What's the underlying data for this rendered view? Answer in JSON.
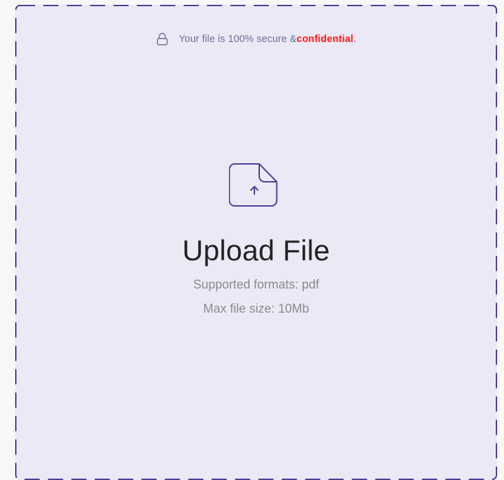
{
  "security_note": {
    "prefix": "Your file is 100% secure & ",
    "highlight": "confidential",
    "suffix": ".",
    "icon": "lock-icon",
    "highlight_color": "#ff1a1a"
  },
  "upload": {
    "icon": "file-upload-icon",
    "title": "Upload File",
    "formats": "Supported formats: pdf",
    "max_size": "Max file size: 10Mb"
  },
  "colors": {
    "dropzone_background": "#ebe9f5",
    "dashed_border": "#4b3f9b",
    "icon_stroke": "#4b3f9b",
    "note_text": "#6c6f9c"
  }
}
